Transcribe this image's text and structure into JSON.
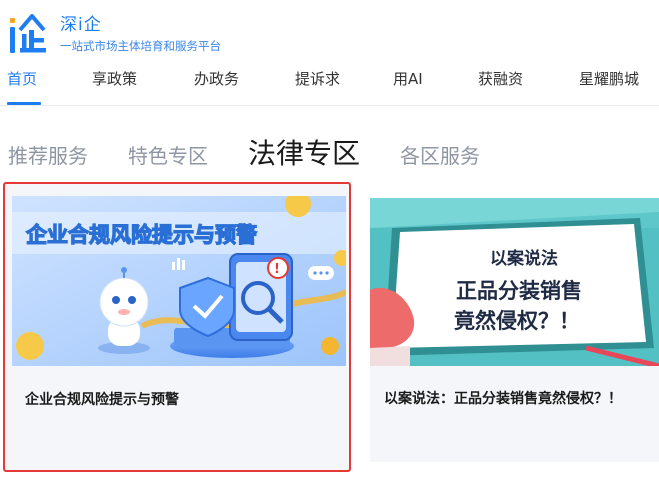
{
  "brand": {
    "name": "深i企",
    "tagline": "一站式市场主体培育和服务平台"
  },
  "nav": {
    "items": [
      {
        "label": "首页"
      },
      {
        "label": "享政策"
      },
      {
        "label": "办政务"
      },
      {
        "label": "提诉求"
      },
      {
        "label": "用AI"
      },
      {
        "label": "获融资"
      },
      {
        "label": "星耀鹏城"
      }
    ],
    "active_index": 0
  },
  "tabs": {
    "items": [
      {
        "label": "推荐服务"
      },
      {
        "label": "特色专区"
      },
      {
        "label": "法律专区"
      },
      {
        "label": "各区服务"
      }
    ],
    "active_index": 2
  },
  "cards": [
    {
      "banner_text": "企业合规风险提示与预警",
      "title": "企业合规风险提示与预警"
    },
    {
      "banner_line1": "以案说法",
      "banner_line2": "正品分装销售",
      "banner_line3": "竟然侵权？！",
      "title": "以案说法：正品分装销售竟然侵权？！"
    }
  ],
  "colors": {
    "accent": "#1e7df0",
    "highlight_border": "#e53935",
    "tab_inactive": "#8f96a3"
  }
}
